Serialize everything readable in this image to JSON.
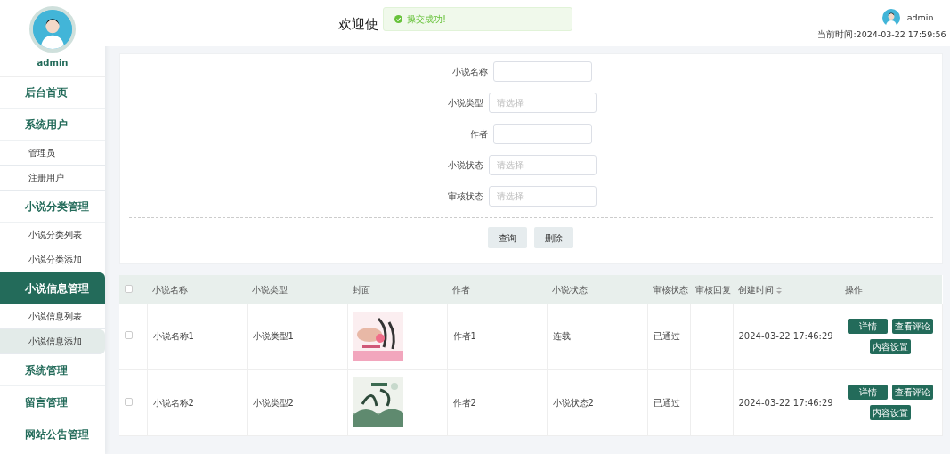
{
  "sidebar": {
    "user": "admin",
    "menu": [
      {
        "label": "后台首页",
        "kind": "group",
        "selected": false
      },
      {
        "label": "系统用户",
        "kind": "group",
        "selected": false
      },
      {
        "label": "管理员",
        "kind": "item",
        "selected": false
      },
      {
        "label": "注册用户",
        "kind": "item",
        "selected": false
      },
      {
        "label": "小说分类管理",
        "kind": "group",
        "selected": false
      },
      {
        "label": "小说分类列表",
        "kind": "item",
        "selected": false
      },
      {
        "label": "小说分类添加",
        "kind": "item",
        "selected": false
      },
      {
        "label": "小说信息管理",
        "kind": "group",
        "selected": true
      },
      {
        "label": "小说信息列表",
        "kind": "item",
        "selected": false
      },
      {
        "label": "小说信息添加",
        "kind": "item",
        "selected": true
      },
      {
        "label": "系统管理",
        "kind": "group",
        "selected": false
      },
      {
        "label": "留言管理",
        "kind": "group",
        "selected": false
      },
      {
        "label": "网站公告管理",
        "kind": "group",
        "selected": false
      }
    ]
  },
  "header": {
    "welcome": "欢迎使",
    "toast": "操交成功!",
    "user": "admin",
    "time_label": "当前时间:",
    "time": "2024-03-22 17:59:56"
  },
  "search_form": {
    "fields": [
      {
        "label": "小说名称",
        "kind": "text"
      },
      {
        "label": "小说类型",
        "kind": "select",
        "placeholder": "请选择"
      },
      {
        "label": "作者",
        "kind": "text"
      },
      {
        "label": "小说状态",
        "kind": "select",
        "placeholder": "请选择"
      },
      {
        "label": "审核状态",
        "kind": "select",
        "placeholder": "请选择"
      }
    ],
    "buttons": [
      "查询",
      "删除"
    ]
  },
  "table": {
    "select_all_checked": false,
    "columns": [
      "小说名称",
      "小说类型",
      "封面",
      "作者",
      "小说状态",
      "审核状态",
      "审核回复",
      "创建时间",
      "操作"
    ],
    "rows": [
      {
        "checked": false,
        "name": "小说名称1",
        "type": "小说类型1",
        "author": "作者1",
        "status": "连载",
        "review": "已通过",
        "created": "2024-03-22 17:46:29",
        "actions": [
          "详情",
          "查看评论",
          "内容设置"
        ]
      },
      {
        "checked": false,
        "name": "小说名称2",
        "type": "小说类型2",
        "author": "作者2",
        "status": "小说状态2",
        "review": "已通过",
        "created": "2024-03-22 17:46:29",
        "actions": [
          "详情",
          "查看评论",
          "内容设置"
        ]
      }
    ]
  }
}
